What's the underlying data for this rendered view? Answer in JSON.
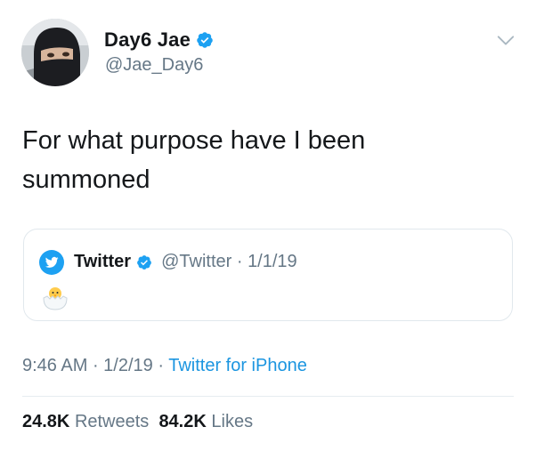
{
  "author": {
    "display_name": "Day6 Jae",
    "handle": "@Jae_Day6",
    "verified_icon": "verified-badge-icon",
    "avatar_icon": "masked-person-avatar"
  },
  "menu": {
    "icon": "chevron-down-icon"
  },
  "tweet": {
    "text_line1": "For what purpose have I been",
    "text_line2": "summoned"
  },
  "quoted_tweet": {
    "display_name": "Twitter",
    "handle": "@Twitter",
    "separator": " · ",
    "date": "1/1/19",
    "content_icon": "hatching-chick-emoji",
    "avatar_icon": "twitter-bird-avatar"
  },
  "meta": {
    "time": "9:46 AM",
    "sep1": " · ",
    "date": "1/2/19",
    "sep2": " · ",
    "source": "Twitter for iPhone"
  },
  "stats": {
    "retweets_count": "24.8K",
    "retweets_label": "Retweets",
    "likes_count": "84.2K",
    "likes_label": "Likes"
  },
  "colors": {
    "accent": "#1b95e0",
    "secondary_text": "#657786",
    "primary_text": "#14171a",
    "verified": "#1da1f2",
    "border": "#e1e8ed"
  }
}
